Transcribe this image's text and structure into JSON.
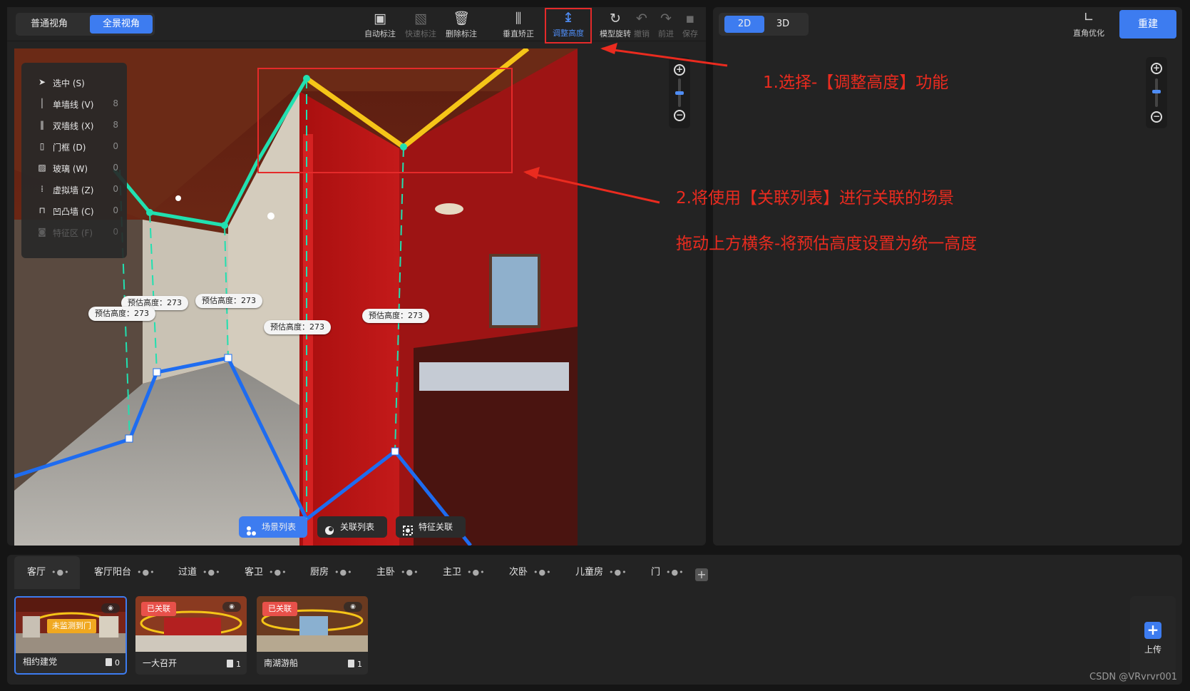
{
  "view_toggle": {
    "normal": "普通视角",
    "panorama": "全景视角",
    "selected": "全景视角"
  },
  "toolbar": [
    {
      "label": "自动标注",
      "icon": "auto-annotate-icon",
      "enabled": true
    },
    {
      "label": "快速标注",
      "icon": "quick-annotate-icon",
      "enabled": false
    },
    {
      "label": "删除标注",
      "icon": "trash-icon",
      "enabled": true
    },
    {
      "label": "垂直矫正",
      "icon": "vertical-correct-icon",
      "enabled": true
    },
    {
      "label": "调整高度",
      "icon": "adjust-height-icon",
      "enabled": true,
      "active": true
    },
    {
      "label": "模型旋转",
      "icon": "rotate-icon",
      "enabled": true
    },
    {
      "label": "撤销",
      "icon": "undo-icon",
      "enabled": false
    },
    {
      "label": "前进",
      "icon": "redo-icon",
      "enabled": false
    },
    {
      "label": "保存",
      "icon": "save-icon",
      "enabled": false
    }
  ],
  "shortcut_menu": [
    {
      "label": "选中 (S)",
      "count": "",
      "icon": "cursor-icon",
      "enabled": true
    },
    {
      "label": "单墙线 (V)",
      "count": "8",
      "icon": "single-wall-icon",
      "enabled": true
    },
    {
      "label": "双墙线 (X)",
      "count": "8",
      "icon": "double-wall-icon",
      "enabled": true
    },
    {
      "label": "门框 (D)",
      "count": "0",
      "icon": "door-frame-icon",
      "enabled": true
    },
    {
      "label": "玻璃 (W)",
      "count": "0",
      "icon": "glass-icon",
      "enabled": true
    },
    {
      "label": "虚拟墙 (Z)",
      "count": "0",
      "icon": "virtual-wall-icon",
      "enabled": true
    },
    {
      "label": "凹凸墙 (C)",
      "count": "0",
      "icon": "bump-wall-icon",
      "enabled": true
    },
    {
      "label": "特征区 (F)",
      "count": "0",
      "icon": "feature-area-icon",
      "enabled": false
    }
  ],
  "height_tags": [
    "预估高度：273",
    "预估高度：273",
    "预估高度：273",
    "预估高度：273",
    "预估高度：273"
  ],
  "scene_buttons": [
    {
      "label": "场景列表",
      "icon": "scene-list-icon",
      "active": true
    },
    {
      "label": "关联列表",
      "icon": "link-list-icon",
      "active": false
    },
    {
      "label": "特征关联",
      "icon": "feature-link-icon",
      "active": false
    }
  ],
  "right": {
    "dim_2d": "2D",
    "dim_3d": "3D",
    "dim_selected": "2D",
    "corner_opt": "直角优化",
    "rebuild": "重建"
  },
  "annotations": {
    "step1": "1.选择-【调整高度】功能",
    "step2": "2.将使用【关联列表】进行关联的场景",
    "step3": "拖动上方横条-将预估高度设置为统一高度"
  },
  "room_tabs": [
    "客厅",
    "客厅阳台",
    "过道",
    "客卫",
    "厨房",
    "主卧",
    "主卫",
    "次卧",
    "儿童房",
    "门"
  ],
  "active_room": "客厅",
  "scene_cards": [
    {
      "name": "相约建党",
      "count": "0",
      "badge": "未监测到门",
      "badge_type": "warning",
      "selected": true
    },
    {
      "name": "一大召开",
      "count": "1",
      "badge": "已关联",
      "badge_type": "linked",
      "selected": false
    },
    {
      "name": "南湖游船",
      "count": "1",
      "badge": "已关联",
      "badge_type": "linked",
      "selected": false
    }
  ],
  "upload": "上传",
  "watermark": "CSDN @VRvrvr001",
  "colors": {
    "accent": "#3d7cf0",
    "annotation_red": "#ea2b1f",
    "ceiling_line": "#f5c518",
    "wall_line": "#21e0b0",
    "floor_line": "#1e6cf0"
  }
}
